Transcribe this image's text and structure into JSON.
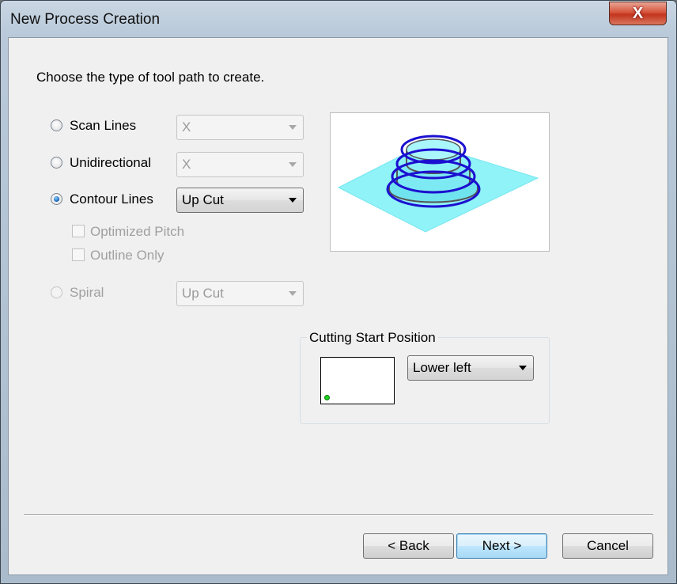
{
  "window": {
    "title": "New Process Creation",
    "close_glyph": "X"
  },
  "instruction": "Choose the type of tool path to create.",
  "options": [
    {
      "label": "Scan Lines",
      "selected": false,
      "enabled": true,
      "combo": {
        "value": "X",
        "enabled": false
      }
    },
    {
      "label": "Unidirectional",
      "selected": false,
      "enabled": true,
      "combo": {
        "value": "X",
        "enabled": false
      }
    },
    {
      "label": "Contour Lines",
      "selected": true,
      "enabled": true,
      "combo": {
        "value": "Up Cut",
        "enabled": true
      }
    },
    {
      "label": "Spiral",
      "selected": false,
      "enabled": false,
      "combo": {
        "value": "Up Cut",
        "enabled": false
      }
    }
  ],
  "checkboxes": [
    {
      "label": "Optimized Pitch",
      "checked": false,
      "enabled": false
    },
    {
      "label": "Outline Only",
      "checked": false,
      "enabled": false
    }
  ],
  "cutting_start": {
    "group_title": "Cutting Start Position",
    "value": "Lower left",
    "marker_color": "#1fd11f"
  },
  "preview": {
    "plane_color": "#8ff3f8",
    "path_color": "#1c10d0",
    "shape_color": "#6fe3ee"
  },
  "buttons": {
    "back": "< Back",
    "next": "Next >",
    "cancel": "Cancel"
  }
}
